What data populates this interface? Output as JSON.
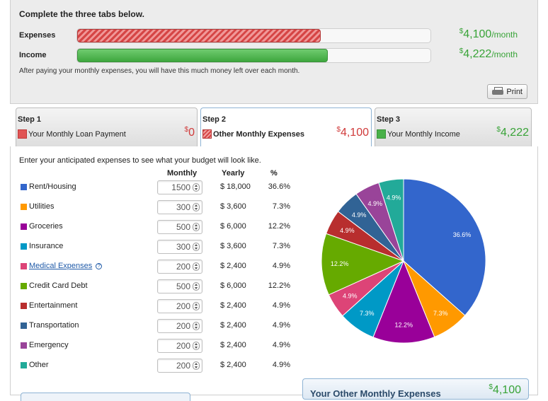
{
  "summary": {
    "heading": "Complete the three tabs below.",
    "expenses_label": "Expenses",
    "income_label": "Income",
    "expenses_amount": "4,100",
    "income_amount": "4,222",
    "currency": "$",
    "per_month": "/month",
    "expenses_fill_fraction": 0.69,
    "income_fill_fraction": 0.71,
    "note": "After paying your monthly expenses, you will have this much money left over each month.",
    "print_label": "Print"
  },
  "tabs": [
    {
      "step": "Step 1",
      "label": "Your Monthly Loan Payment",
      "amount": "0",
      "active": false
    },
    {
      "step": "Step 2",
      "label": "Other Monthly Expenses",
      "amount": "4,100",
      "active": true
    },
    {
      "step": "Step 3",
      "label": "Your Monthly Income",
      "amount": "4,222",
      "active": false
    }
  ],
  "expenses": {
    "intro": "Enter your anticipated expenses to see what your budget will look like.",
    "headers": {
      "monthly": "Monthly",
      "yearly": "Yearly",
      "pct": "%"
    },
    "rows": [
      {
        "name": "Rent/Housing",
        "monthly": "1500",
        "yearly": "$ 18,000",
        "pct": "36.6%",
        "color": "#3366cc"
      },
      {
        "name": "Utilities",
        "monthly": "300",
        "yearly": "$ 3,600",
        "pct": "7.3%",
        "color": "#ff9900"
      },
      {
        "name": "Groceries",
        "monthly": "500",
        "yearly": "$ 6,000",
        "pct": "12.2%",
        "color": "#990099"
      },
      {
        "name": "Insurance",
        "monthly": "300",
        "yearly": "$ 3,600",
        "pct": "7.3%",
        "color": "#0099c6"
      },
      {
        "name": "Medical Expenses",
        "monthly": "200",
        "yearly": "$ 2,400",
        "pct": "4.9%",
        "color": "#dd4477",
        "link": true
      },
      {
        "name": "Credit Card Debt",
        "monthly": "500",
        "yearly": "$ 6,000",
        "pct": "12.2%",
        "color": "#66aa00"
      },
      {
        "name": "Entertainment",
        "monthly": "200",
        "yearly": "$ 2,400",
        "pct": "4.9%",
        "color": "#b82e2e"
      },
      {
        "name": "Transportation",
        "monthly": "200",
        "yearly": "$ 2,400",
        "pct": "4.9%",
        "color": "#316395"
      },
      {
        "name": "Emergency",
        "monthly": "200",
        "yearly": "$ 2,400",
        "pct": "4.9%",
        "color": "#994499"
      },
      {
        "name": "Other",
        "monthly": "200",
        "yearly": "$ 2,400",
        "pct": "4.9%",
        "color": "#22aa99"
      }
    ]
  },
  "chart_data": {
    "type": "pie",
    "categories": [
      "Rent/Housing",
      "Utilities",
      "Groceries",
      "Insurance",
      "Medical Expenses",
      "Credit Card Debt",
      "Entertainment",
      "Transportation",
      "Emergency",
      "Other"
    ],
    "values": [
      36.6,
      7.3,
      12.2,
      7.3,
      4.9,
      12.2,
      4.9,
      4.9,
      4.9,
      4.9
    ],
    "labels": [
      "36.6%",
      "7.3%",
      "12.2%",
      "7.3%",
      "4.9%",
      "12.2%",
      "4.9%",
      "4.9%",
      "4.9%",
      "4.9%"
    ],
    "colors": [
      "#3366cc",
      "#ff9900",
      "#990099",
      "#0099c6",
      "#dd4477",
      "#66aa00",
      "#b82e2e",
      "#316395",
      "#994499",
      "#22aa99"
    ]
  },
  "footer": {
    "label": "Your Other Monthly Expenses",
    "amount": "4,100"
  }
}
